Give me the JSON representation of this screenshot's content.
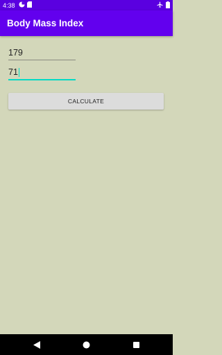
{
  "status_bar": {
    "time": "4:38",
    "left_icons": [
      "pie-chart-icon",
      "sd-card-icon"
    ],
    "right_icons": [
      "airplane-mode-icon",
      "battery-icon"
    ]
  },
  "app_bar": {
    "title": "Body Mass Index",
    "color": "#6200ee"
  },
  "form": {
    "height_value": "179",
    "weight_value": "71",
    "focused_field": "weight",
    "accent_color": "#03dac5",
    "calculate_label": "CALCULATE"
  },
  "nav_bar": {
    "buttons": [
      "back-icon",
      "home-icon",
      "recents-icon"
    ]
  },
  "background_color": "#d3d7ba"
}
